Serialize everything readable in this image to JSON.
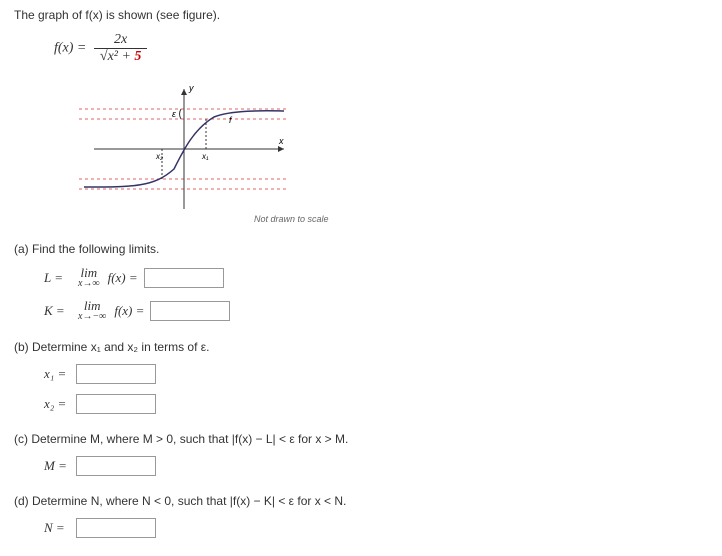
{
  "intro": "The graph of f(x) is shown (see figure).",
  "formula": {
    "lhs": "f(x) =",
    "num": "2x",
    "den_pre": "x² + ",
    "den_const": "5"
  },
  "figure": {
    "not_drawn": "Not drawn to scale",
    "labels": {
      "y": "y",
      "x": "x",
      "f": "f",
      "eps": "ε",
      "x1": "x₁",
      "x2": "x₂"
    }
  },
  "parts": {
    "a": {
      "prompt": "(a) Find the following limits.",
      "L": {
        "label": "L  =",
        "lim": "lim",
        "sub": "x→∞",
        "fx": "f(x) ="
      },
      "K": {
        "label": "K  =",
        "lim": "lim",
        "sub": "x→−∞",
        "fx": "f(x) ="
      }
    },
    "b": {
      "prompt": "(b) Determine x₁ and x₂ in terms of ε.",
      "x1": "x₁ =",
      "x2": "x₂ ="
    },
    "c": {
      "prompt": "(c) Determine M, where M > 0, such that |f(x) − L| < ε for x > M.",
      "label": "M ="
    },
    "d": {
      "prompt": "(d) Determine N, where N < 0, such that |f(x) − K| < ε for x < N.",
      "label": "N ="
    }
  }
}
